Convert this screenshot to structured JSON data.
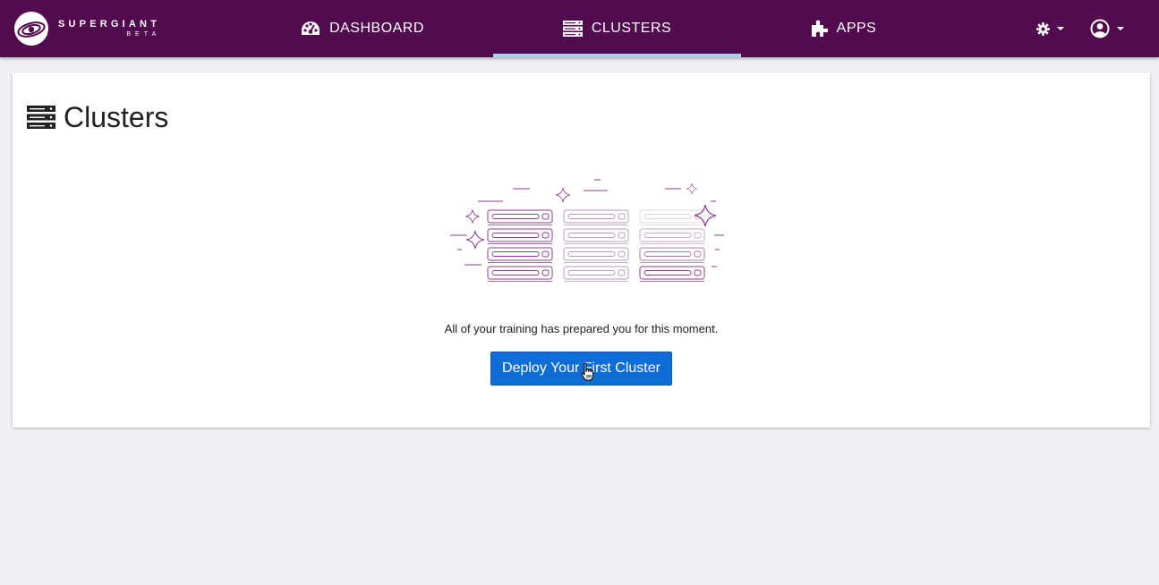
{
  "brand": {
    "name": "SUPERGIANT",
    "sub": "BETA"
  },
  "nav": {
    "tabs": [
      {
        "label": "DASHBOARD",
        "icon": "dashboard-icon"
      },
      {
        "label": "CLUSTERS",
        "icon": "server-icon",
        "active": true
      },
      {
        "label": "APPS",
        "icon": "puzzle-icon"
      }
    ],
    "settings_icon": "gear-icon",
    "user_icon": "user-circle-icon"
  },
  "page": {
    "title": "Clusters",
    "title_icon": "server-icon"
  },
  "empty_state": {
    "message": "All of your training has prepared you for this moment.",
    "button_label": "Deploy Your First Cluster"
  },
  "colors": {
    "navbar": "#520b4f",
    "active_tab_underline": "#a9d3f2",
    "primary_button": "#0e6dd6",
    "illustration_stroke": "#8a3f8a"
  }
}
